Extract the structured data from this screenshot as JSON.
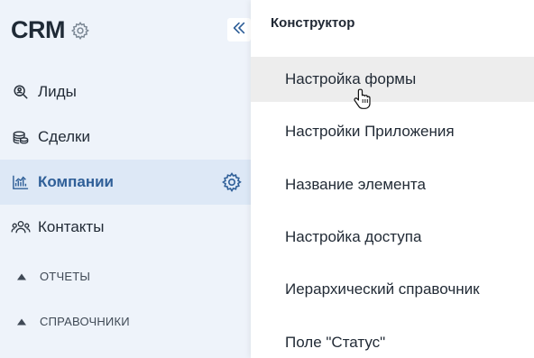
{
  "brand": {
    "title": "CRM",
    "settings_icon": "gear-icon"
  },
  "sidebar": {
    "collapse_icon": "double-chevron-left-icon",
    "items": [
      {
        "label": "Лиды",
        "icon": "search-person-icon",
        "active": false
      },
      {
        "label": "Сделки",
        "icon": "coins-icon",
        "active": false
      },
      {
        "label": "Компании",
        "icon": "chart-icon",
        "active": true
      },
      {
        "label": "Контакты",
        "icon": "people-icon",
        "active": false
      }
    ],
    "sections": [
      {
        "label": "ОТЧЕТЫ",
        "icon": "triangle-up-icon"
      },
      {
        "label": "СПРАВОЧНИКИ",
        "icon": "triangle-up-icon"
      }
    ]
  },
  "dropdown": {
    "title": "Конструктор",
    "items": [
      {
        "label": "Настройка формы",
        "hovered": true
      },
      {
        "label": "Настройки Приложения",
        "hovered": false
      },
      {
        "label": "Название элемента",
        "hovered": false
      },
      {
        "label": "Настройка доступа",
        "hovered": false
      },
      {
        "label": "Иерархический справочник",
        "hovered": false
      },
      {
        "label": "Поле \"Статус\"",
        "hovered": false
      }
    ]
  },
  "colors": {
    "sidebar_bg": "#eef3fa",
    "active_bg": "#dde8f6",
    "active_text": "#2f5f98",
    "hover_bg": "#ededed",
    "accent": "#2f5f98"
  }
}
